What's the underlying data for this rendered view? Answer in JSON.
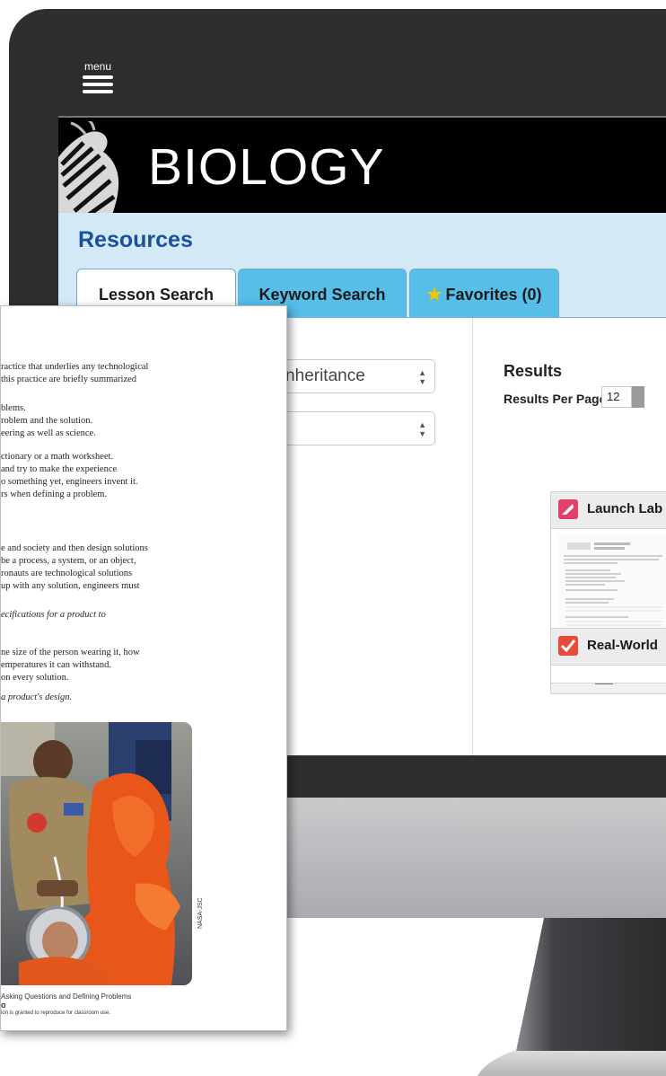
{
  "app": {
    "menu_label": "menu",
    "banner_title": "BIOLOGY",
    "resources_title": "Resources"
  },
  "tabs": [
    {
      "label": "Lesson Search",
      "active": true
    },
    {
      "label": "Keyword Search",
      "active": false
    },
    {
      "label": "Favorites (0)",
      "active": false
    }
  ],
  "filters": {
    "topic_value": "k Inheritance",
    "second_value": ""
  },
  "results": {
    "title": "Results",
    "per_page_label": "Results Per Page",
    "per_page_value": "12"
  },
  "cards": [
    {
      "title": "Launch Lab",
      "icon": "launch-lab-icon",
      "icon_color": "#e0406b"
    },
    {
      "title": "Real-World",
      "icon": "checkmark-icon",
      "icon_color": "#e74b3c"
    }
  ],
  "worksheet": {
    "paragraph1": [
      "ractice that underlies any technological",
      "this practice are briefly summarized"
    ],
    "list1": [
      "blems.",
      "roblem and the solution.",
      "eering as well as science."
    ],
    "list2": [
      "ctionary or a math worksheet.",
      "and try to make the experience",
      "o something yet, engineers invent it.",
      "rs when defining a problem."
    ],
    "paragraph2": [
      "e and society and then design solutions",
      "be a process, a system, or an object,",
      "ronauts are technological solutions",
      "up with any solution, engineers must"
    ],
    "italic1": "ecifications for a product to",
    "paragraph3": [
      "ne size of the person wearing it, how",
      "emperatures it can withstand.",
      "on every solution."
    ],
    "italic2": "a product's design.",
    "photo_credit": "NASA-JSC",
    "footer_title": "Asking Questions and Defining Problems",
    "footer_bold": "o",
    "footer_note": "ion is granted to reproduce for classroom use."
  },
  "colors": {
    "resources_blue": "#1c4f9c",
    "tab_blue": "#57bde9",
    "band_blue": "#d3eaf6",
    "star_yellow": "#f3c400"
  }
}
